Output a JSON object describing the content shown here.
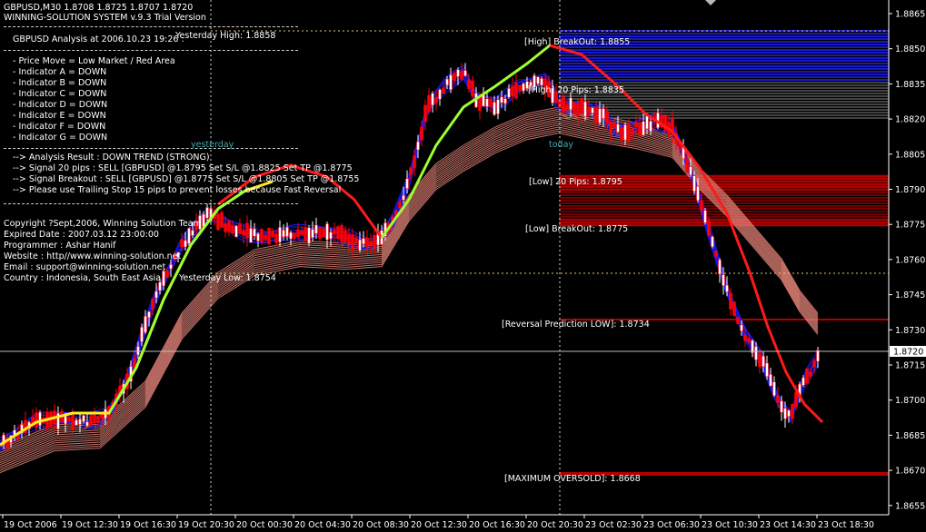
{
  "header": {
    "symbol_line": "GBPUSD,M30  1.8708 1.8725 1.8707 1.8720",
    "system_line": "WINNING-SOLUTION SYSTEM v.9.3 Trial Version"
  },
  "analysis": {
    "title": "GBPUSD Analysis at 2006.10.23 19:26 :",
    "lines": [
      "- Price Move = Low Market / Red Area",
      "- Indicator A = DOWN",
      "- Indicator B = DOWN",
      "- Indicator C = DOWN",
      "- Indicator D = DOWN",
      "- Indicator E = DOWN",
      "- Indicator F = DOWN",
      "- Indicator G = DOWN"
    ],
    "results": [
      "--> Analysis Result : DOWN TREND (STRONG)",
      "--> Signal 20 pips : SELL [GBPUSD] @1.8795 Set S/L @1.8825 Set TP @1.8775",
      "--> Signal Breakout : SELL [GBPUSD] @1.8775 Set S/L @1.8805 Set TP @1.8755",
      "--> Please use Trailing Stop 15 pips to prevent losses because Fast Reversal"
    ]
  },
  "credits": [
    "Copyright ?Sept,2006, Winning Solution Team",
    "Expired Date : 2007.03.12 23:00:00",
    "Programmer : Ashar Hanif",
    "Website : http//www.winning-solution.net",
    "Email : support@winning-solution.net",
    "Country : Indonesia, South East Asia"
  ],
  "markers": {
    "yesterday": "yesterday",
    "today": "today",
    "yesterday_high": "Yesterday High: 1.8858",
    "yesterday_low": "Yesterday Low: 1.8754"
  },
  "levels": {
    "high_breakout": "[High] BreakOut: 1.8855",
    "high_20": "[High] 20 Pips: 1.8835",
    "low_20": "[Low] 20 Pips: 1.8795",
    "low_breakout": "[Low] BreakOut: 1.8775",
    "reversal_low": "[Reversal Prediction LOW]: 1.8734",
    "max_oversold": "[MAXIMUM OVERSOLD]: 1.8668"
  },
  "price_axis": {
    "ticks": [
      "1.8865",
      "1.8850",
      "1.8835",
      "1.8820",
      "1.8805",
      "1.8790",
      "1.8775",
      "1.8760",
      "1.8745",
      "1.8730",
      "1.8715",
      "1.8700",
      "1.8685",
      "1.8670",
      "1.8655"
    ],
    "current_price": "1.8720"
  },
  "time_axis": {
    "ticks": [
      "19 Oct 2006",
      "19 Oct 12:30",
      "19 Oct 16:30",
      "19 Oct 20:30",
      "20 Oct 00:30",
      "20 Oct 04:30",
      "20 Oct 08:30",
      "20 Oct 12:30",
      "20 Oct 16:30",
      "20 Oct 20:30",
      "23 Oct 02:30",
      "23 Oct 06:30",
      "23 Oct 10:30",
      "23 Oct 14:30",
      "23 Oct 18:30"
    ]
  },
  "colors": {
    "background": "#000000",
    "candles_bull": "#ffffff",
    "candles_bear": "#ff0000",
    "ribbon_blue": "#1a1aff",
    "ribbon_salmon": "#e8867a",
    "trend_green": "#9dff2e",
    "trend_red": "#ff1a1a",
    "band_blue": "#1818c8",
    "band_red": "#b00000"
  }
}
